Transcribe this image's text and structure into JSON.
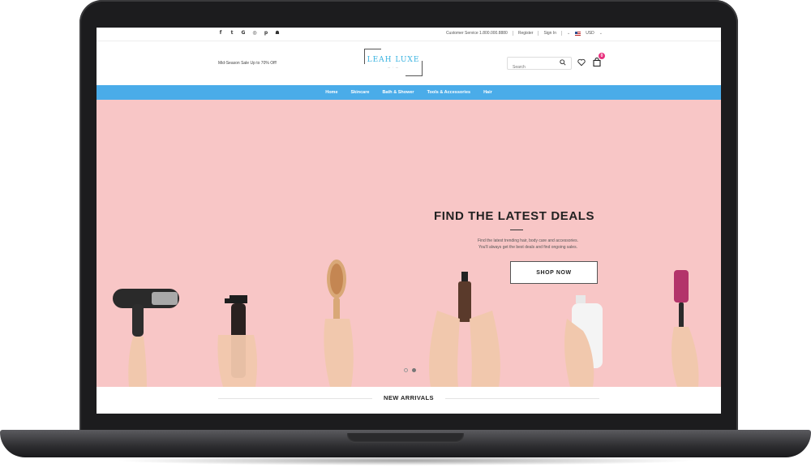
{
  "topbar": {
    "socials": [
      "facebook-icon",
      "twitter-icon",
      "google-plus-icon",
      "instagram-icon",
      "pinterest-icon",
      "snapchat-icon"
    ],
    "customer_service": "Customer Service 1.800.000.8880",
    "register": "Register",
    "sign_in": "Sign In",
    "currency": "USD"
  },
  "header": {
    "promo": "Mid-Season Sale Up to 70% Off!",
    "logo_text": "LEAH LUXE",
    "search_placeholder": "Search",
    "cart_count": "0"
  },
  "nav": {
    "items": [
      "Home",
      "Skincare",
      "Bath & Shower",
      "Tools & Accessories",
      "Hair"
    ]
  },
  "hero": {
    "title": "FIND THE LATEST DEALS",
    "text_line1": "Find the latest trending hair, body care and accessories.",
    "text_line2": "You'll always get the best deals and find ongoing sales.",
    "button": "SHOP NOW",
    "slides": 2,
    "active_slide": 2,
    "background": "#f8c6c6"
  },
  "section": {
    "title": "NEW ARRIVALS"
  },
  "colors": {
    "nav": "#4aace9",
    "badge": "#e8317e",
    "logo": "#3ab3e0"
  }
}
